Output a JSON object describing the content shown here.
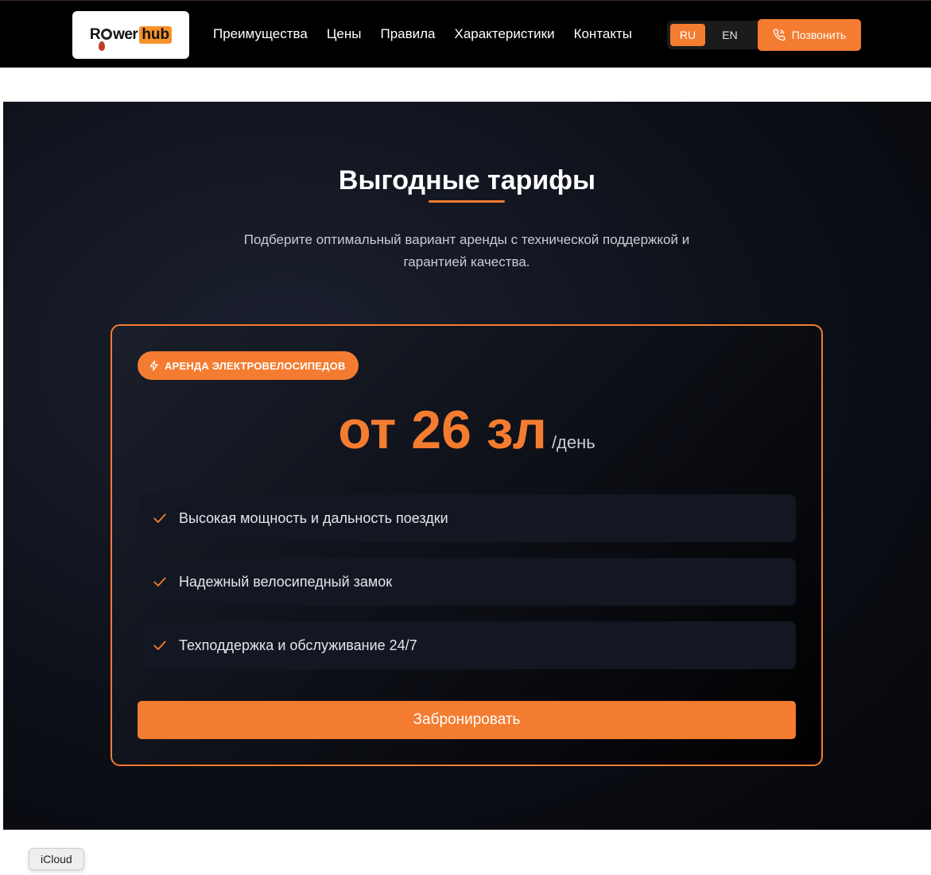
{
  "header": {
    "logo": {
      "text_left": "R",
      "text_mid": "wer",
      "text_right": "hub"
    },
    "nav": [
      "Преимущества",
      "Цены",
      "Правила",
      "Характеристики",
      "Контакты"
    ],
    "lang": {
      "active": "RU",
      "inactive": "EN"
    },
    "call_button": "Позвонить"
  },
  "pricing": {
    "title": "Выгодные тарифы",
    "subtitle_line1": "Подберите оптимальный вариант аренды с технической поддержкой и",
    "subtitle_line2": "гарантией качества.",
    "badge": "АРЕНДА ЭЛЕКТРОВЕЛОСИПЕДОВ",
    "price": "от 26 зл",
    "period": "/день",
    "features": [
      "Высокая мощность и дальность поездки",
      "Надежный велосипедный замок",
      "Техподдержка и обслуживание 24/7"
    ],
    "book_button": "Забронировать"
  },
  "tooltip": "iCloud",
  "colors": {
    "accent": "#f47c30",
    "background": "#0d1018",
    "header": "#000000"
  }
}
